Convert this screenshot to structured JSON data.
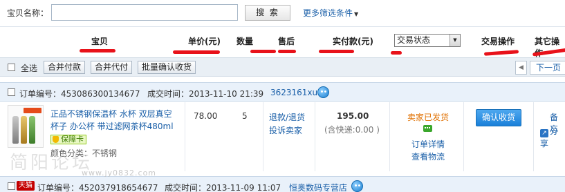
{
  "search": {
    "label": "宝贝名称：",
    "value": "",
    "button": "搜 索",
    "more_filters": "更多筛选条件"
  },
  "header": {
    "columns": [
      "宝贝",
      "单价(元)",
      "数量",
      "售后",
      "实付款(元)"
    ],
    "status_select": "交易状态",
    "trade_ops": "交易操作",
    "other_ops": "其它操作"
  },
  "toolbar": {
    "select_all": "全选",
    "buttons": [
      "合并付款",
      "合并代付",
      "批量确认收货"
    ],
    "prev": "◀",
    "next": "下一页"
  },
  "orders": [
    {
      "order_no_label": "订单编号：",
      "order_no": "453086300134677",
      "time_label": "成交时间：",
      "time": "2013-11-10 21:39",
      "seller": "3623161xu",
      "item": {
        "title": "正品不锈钢保温杯 水杯 双层真空杯子 办公杯 带过滤网茶杯480ml",
        "guarantee": "保障卡",
        "attr": "颜色分类：不锈钢",
        "price": "78.00",
        "qty": "5",
        "refund": "退款/退货",
        "complain": "投诉卖家",
        "paid": "195.00",
        "shipping": "(含快递:0.00 )",
        "status": "卖家已发货",
        "detail": "订单详情",
        "logistics": "查看物流",
        "confirm": "确认收货",
        "note": "备忘",
        "share": "分享"
      }
    },
    {
      "tag": "天猫",
      "order_no_label": "订单编号：",
      "order_no": "452037918654677",
      "time_label": "成交时间：",
      "time": "2013-11-09 11:07",
      "seller": "恒奥数码专营店"
    }
  ],
  "watermark": {
    "text": "简阳论坛",
    "url": "www.jy0832.com"
  },
  "colors": {
    "link": "#1a5fa8",
    "underline": "#e8121a",
    "status": "#e07000",
    "confirm_button": "#1a80d9"
  }
}
